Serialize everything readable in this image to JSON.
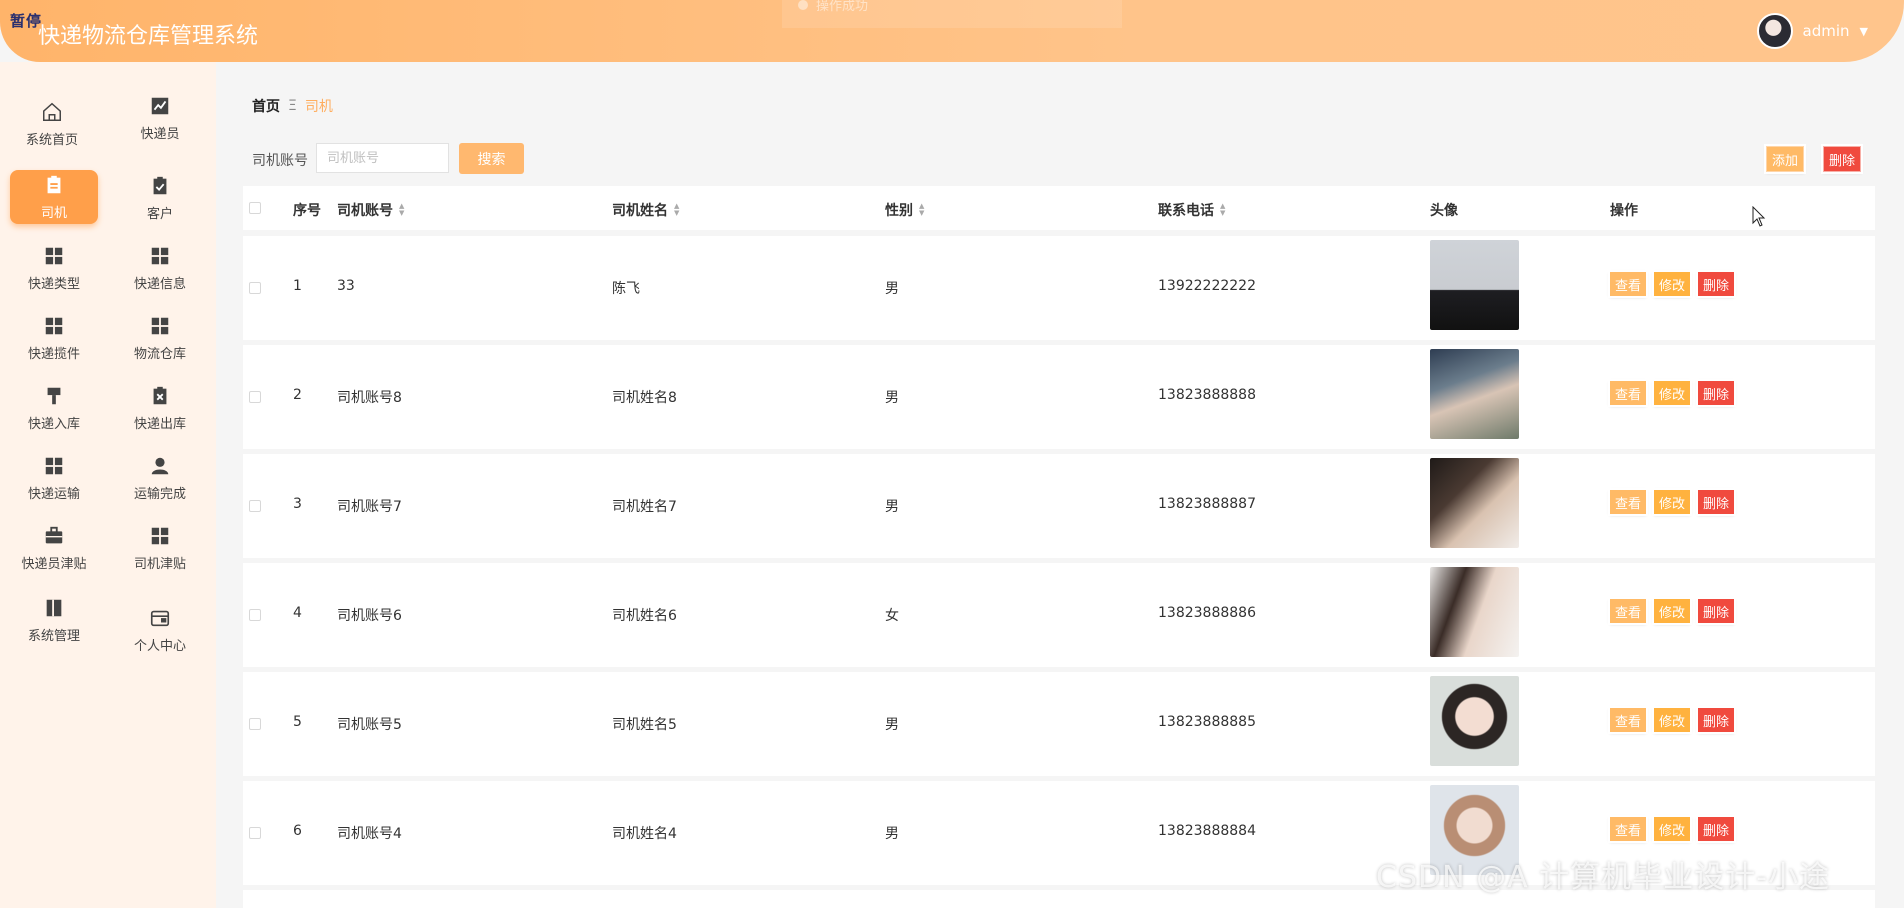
{
  "header": {
    "title": "快递物流仓库管理系统",
    "pause_tag": "暂停",
    "ghost_tip": "操作成功",
    "username": "admin"
  },
  "sidebar": {
    "items": [
      {
        "label": "系统首页",
        "icon": "home-icon"
      },
      {
        "label": "快递员",
        "icon": "chart-icon"
      },
      {
        "label": "司机",
        "icon": "clipboard-icon",
        "active": true
      },
      {
        "label": "客户",
        "icon": "clipboard-check-icon"
      },
      {
        "label": "快递类型",
        "icon": "grid-icon"
      },
      {
        "label": "快递信息",
        "icon": "grid-icon"
      },
      {
        "label": "快递揽件",
        "icon": "grid-icon"
      },
      {
        "label": "物流仓库",
        "icon": "grid-icon"
      },
      {
        "label": "快递入库",
        "icon": "hammer-icon"
      },
      {
        "label": "快递出库",
        "icon": "clipboard-x-icon"
      },
      {
        "label": "快递运输",
        "icon": "grid-icon"
      },
      {
        "label": "运输完成",
        "icon": "user-icon"
      },
      {
        "label": "快递员津贴",
        "icon": "briefcase-icon"
      },
      {
        "label": "司机津贴",
        "icon": "grid-icon"
      },
      {
        "label": "系统管理",
        "icon": "book-icon"
      },
      {
        "label": "个人中心",
        "icon": "wallet-icon"
      }
    ]
  },
  "breadcrumb": {
    "home": "首页",
    "separator": "Ξ",
    "current": "司机"
  },
  "search": {
    "label": "司机账号",
    "placeholder": "司机账号",
    "button": "搜索"
  },
  "actions": {
    "add": "添加",
    "delete": "删除"
  },
  "table": {
    "headers": {
      "index": "序号",
      "account": "司机账号",
      "name": "司机姓名",
      "gender": "性别",
      "phone": "联系电话",
      "avatar": "头像",
      "ops": "操作"
    },
    "op_labels": {
      "view": "查看",
      "edit": "修改",
      "delete": "删除"
    },
    "rows": [
      {
        "index": "1",
        "account": "33",
        "name": "陈飞",
        "gender": "男",
        "phone": "13922222222"
      },
      {
        "index": "2",
        "account": "司机账号8",
        "name": "司机姓名8",
        "gender": "男",
        "phone": "13823888888"
      },
      {
        "index": "3",
        "account": "司机账号7",
        "name": "司机姓名7",
        "gender": "男",
        "phone": "13823888887"
      },
      {
        "index": "4",
        "account": "司机账号6",
        "name": "司机姓名6",
        "gender": "女",
        "phone": "13823888886"
      },
      {
        "index": "5",
        "account": "司机账号5",
        "name": "司机姓名5",
        "gender": "男",
        "phone": "13823888885"
      },
      {
        "index": "6",
        "account": "司机账号4",
        "name": "司机姓名4",
        "gender": "男",
        "phone": "13823888884"
      }
    ]
  },
  "watermark": "CSDN @A 计算机毕业设计-小途",
  "colors": {
    "accent": "#ffb46a",
    "danger": "#f04a3e",
    "sidebar_bg": "#fff3ea"
  }
}
